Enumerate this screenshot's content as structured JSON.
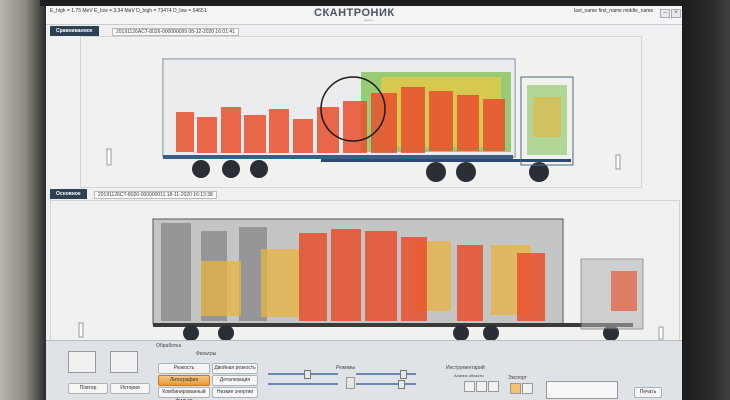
{
  "titlebar": {
    "stats": "E_high = 1.75 MeV   E_low = 3.34 MeV   D_high = 73474   D_low = 54651",
    "logo": "СКАНТРОНИК",
    "logo_sub": "system",
    "user": "last_name first_name middle_name"
  },
  "compare_pane": {
    "tab_label": "Сравниваемое",
    "info": "20191126ACT-8026-000000099   08-12-2020 16:01:41"
  },
  "main_pane": {
    "tab_label": "Основное",
    "info": "20191126CT-8026-000000011   18-11-2020 16:13:38"
  },
  "toolbar": {
    "left_buttons": [
      {
        "label": "Повтор"
      },
      {
        "label": "История"
      }
    ],
    "processing": {
      "title": "Обработка",
      "buttons": [
        {
          "label": "Резкость"
        },
        {
          "label": "Литография"
        },
        {
          "label": "Комбинированный фильтр"
        }
      ]
    },
    "filters": {
      "title": "Фильтры",
      "buttons": [
        {
          "label": "Двойная резкость"
        },
        {
          "label": "Детализация"
        },
        {
          "label": "Низкие энергии"
        }
      ]
    },
    "modes": {
      "title": "Режимы"
    },
    "tools": {
      "title": "Инструментарий",
      "area_label": "Анализ области",
      "export_label": "Экспорт"
    },
    "print_label": "Печать"
  },
  "colors": {
    "header_dark": "#2d4154",
    "accent_orange": "#e99a37",
    "heat_red": "#e8502f",
    "heat_green": "#7cc04a"
  }
}
